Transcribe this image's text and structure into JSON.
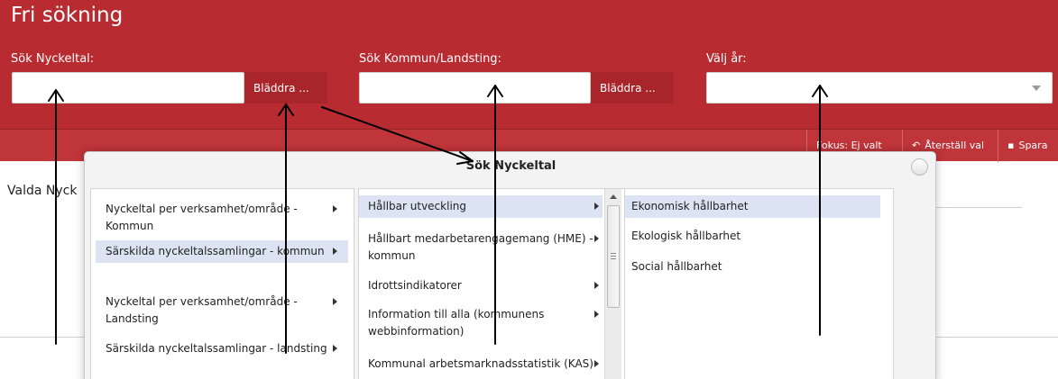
{
  "header": {
    "title": "Fri sökning",
    "nyckeltal_label": "Sök Nyckeltal:",
    "kommun_label": "Sök Kommun/Landsting:",
    "year_label": "Välj år:",
    "browse_label_1": "Bläddra ...",
    "browse_label_2": "Bläddra ...",
    "nyckeltal_value": "",
    "kommun_value": "",
    "year_value": ""
  },
  "toolbar": {
    "focus_label": "Fokus: Ej valt",
    "reset_label": "Återställ val",
    "save_label": "Spara"
  },
  "main": {
    "valda_label": "Valda Nyck"
  },
  "dialog": {
    "title": "Sök Nyckeltal",
    "column1": [
      {
        "label": "Nyckeltal per verksamhet/område - Kommun",
        "selected": false
      },
      {
        "label": "Särskilda nyckeltalssamlingar - kommun",
        "selected": true
      },
      {
        "label": "Nyckeltal per verksamhet/område - Landsting",
        "selected": false
      },
      {
        "label": "Särskilda nyckeltalssamlingar - landsting",
        "selected": false
      }
    ],
    "column2": [
      {
        "label": "Hållbar utveckling",
        "selected": true
      },
      {
        "label": "Hållbart medarbetarengagemang (HME) - kommun",
        "selected": false
      },
      {
        "label": "Idrottsindikatorer",
        "selected": false
      },
      {
        "label": "Information till alla (kommunens webbinformation)",
        "selected": false
      },
      {
        "label": "Kommunal arbetsmarknadsstatistik (KAS)",
        "selected": false
      }
    ],
    "column3": [
      {
        "label": "Ekonomisk hållbarhet",
        "selected": true
      },
      {
        "label": "Ekologisk hållbarhet",
        "selected": false
      },
      {
        "label": "Social hållbarhet",
        "selected": false
      }
    ]
  },
  "colors": {
    "header_red": "#b82b31",
    "toolbar_red": "#c0353a",
    "selection_blue": "#dce4f3"
  },
  "icons": [
    "caret-down-icon",
    "chevron-right-icon",
    "reset-icon",
    "save-icon",
    "close-icon",
    "scroll-up-icon",
    "annotation-arrow-icon"
  ]
}
